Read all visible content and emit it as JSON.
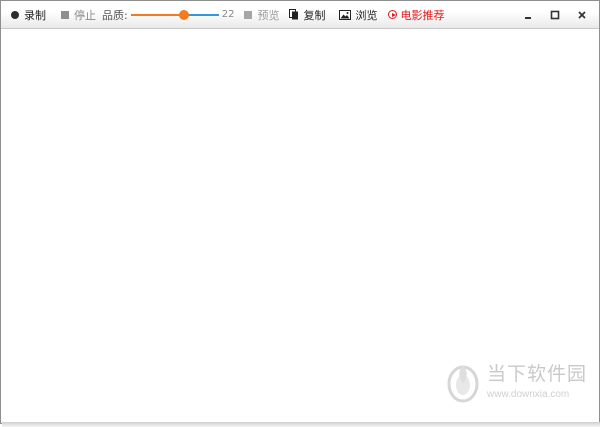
{
  "toolbar": {
    "record_label": "录制",
    "stop_label": "停止",
    "quality_label": "品质:",
    "quality_value": "22",
    "quality_fraction": 0.6,
    "preview_label": "预览",
    "copy_label": "复制",
    "browse_label": "浏览",
    "movie_label": "电影推荐"
  },
  "window_controls": {
    "minimize": "minimize-icon",
    "maximize": "maximize-icon",
    "close": "close-icon"
  },
  "watermark": {
    "name": "当下软件园",
    "url": "www.downxia.com"
  },
  "colors": {
    "slider_filled": "#f07b22",
    "slider_empty": "#3399dd",
    "movie_accent": "#e11a1a",
    "disabled_text": "#9a9a9a"
  }
}
